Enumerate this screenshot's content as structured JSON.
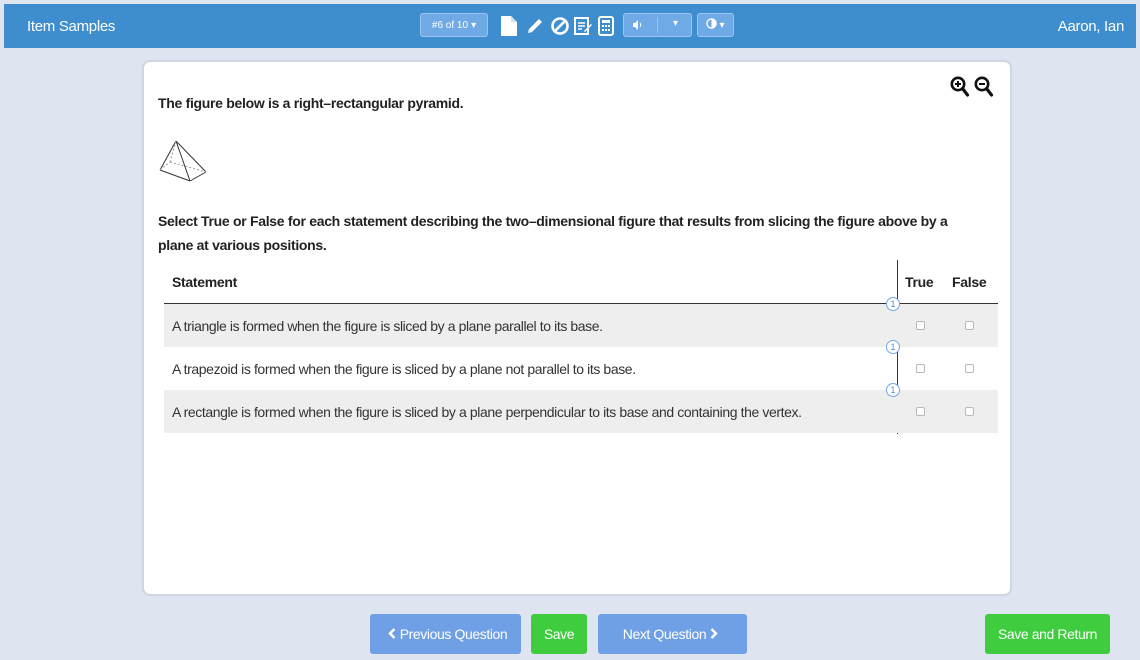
{
  "header": {
    "app_title": "Item Samples",
    "user_name": "Aaron, Ian",
    "question_counter": "#6 of 10",
    "caret": "▾",
    "icons": [
      "document-icon",
      "pencil-icon",
      "no-symbol-icon",
      "notepad-icon",
      "calculator-icon",
      "speaker-icon",
      "contrast-icon"
    ],
    "colors": {
      "bar": "#3e8dcf",
      "button": "#6fa9e6"
    }
  },
  "question": {
    "intro": "The figure below is a right–rectangular pyramid.",
    "instructions": "Select True or False for each statement describing the two–dimensional figure that results from slicing the figure above by a plane at various positions.",
    "zoom_icons": [
      "zoom-in-icon",
      "zoom-out-icon"
    ]
  },
  "table": {
    "headers": {
      "statement": "Statement",
      "true": "True",
      "false": "False"
    },
    "rows": [
      {
        "statement": "A triangle is formed when the figure is sliced by a plane parallel to its base.",
        "badge": "1"
      },
      {
        "statement": "A trapezoid is formed when the figure is sliced by a plane not parallel to its base.",
        "badge": "1"
      },
      {
        "statement": "A rectangle is formed when the figure is sliced by a plane perpendicular to its base and containing the vertex.",
        "badge": "1"
      }
    ]
  },
  "footer": {
    "previous_label": "Previous Question",
    "save_label": "Save",
    "next_label": "Next Question",
    "save_return_label": "Save and Return",
    "colors": {
      "blue": "#6fa0e6",
      "green": "#3fcc3f"
    }
  }
}
